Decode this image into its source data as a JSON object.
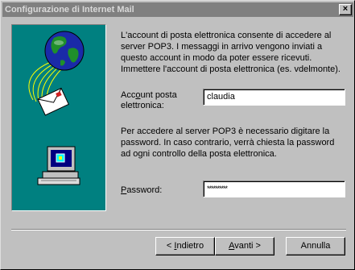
{
  "window": {
    "title": "Configurazione di Internet Mail",
    "close_glyph": "×"
  },
  "intro_text": "L'account di posta elettronica consente di accedere al server POP3. I messaggi in arrivo vengono inviati a questo account in modo da poter essere ricevuti. Immettere l'account di posta elettronica (es. vdelmonte).",
  "account": {
    "label_prefix": "Acc",
    "label_accel": "o",
    "label_suffix": "unt posta elettronica:",
    "value": "claudia"
  },
  "password_text": "Per accedere al server POP3 è necessario digitare la password. In caso contrario, verrà chiesta la password ad ogni controllo della posta elettronica.",
  "password": {
    "label_accel": "P",
    "label_suffix": "assword:",
    "value": "**********"
  },
  "buttons": {
    "back_prefix": "< ",
    "back_accel": "I",
    "back_suffix": "ndietro",
    "next_accel": "A",
    "next_suffix": "vanti >",
    "cancel": "Annulla"
  },
  "colors": {
    "art_background": "#008080",
    "title_bar": "#808080",
    "dialog": "#c0c0c0"
  },
  "icons": [
    "globe-icon",
    "envelope-icon",
    "computer-icon"
  ]
}
